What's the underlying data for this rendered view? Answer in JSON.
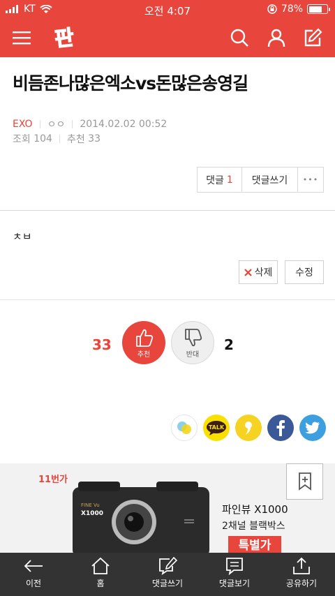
{
  "status_bar": {
    "carrier": "KT",
    "time": "오전 4:07",
    "battery": "78%",
    "battery_level": 0.78
  },
  "header": {
    "logo_text": "판",
    "icons": [
      "menu-icon",
      "search-icon",
      "user-icon",
      "edit-icon"
    ]
  },
  "post": {
    "title": "비듬존나많은엑소vs돈많은송영길",
    "category": "EXO",
    "author": "ㅇㅇ",
    "date": "2014.02.02 00:52",
    "views_label": "조회",
    "views": "104",
    "recommend_label": "추천",
    "recommend": "33",
    "body": "ㅊㅂ"
  },
  "actions": {
    "comment_label": "댓글",
    "comment_count": "1",
    "write_comment": "댓글쓰기",
    "more": "•••"
  },
  "edit": {
    "delete_label": "삭제",
    "edit_label": "수정"
  },
  "votes": {
    "up_count": "33",
    "up_label": "추천",
    "down_label": "반대",
    "down_count": "2"
  },
  "share": {
    "icons": [
      "kakaostory-icon",
      "kakaotalk-icon",
      "comma-icon",
      "facebook-icon",
      "twitter-icon"
    ],
    "talk_label": "TALK"
  },
  "ad": {
    "badge": "11번가",
    "product_title": "파인뷰 X1000",
    "product_sub": "2채널 블랙박스",
    "special_label": "특별가",
    "device_brand": "FINE Vu",
    "device_model": "X1000"
  },
  "bottom_nav": [
    {
      "label": "이전",
      "icon": "back-arrow-icon"
    },
    {
      "label": "홈",
      "icon": "home-icon"
    },
    {
      "label": "댓글쓰기",
      "icon": "write-comment-icon"
    },
    {
      "label": "댓글보기",
      "icon": "view-comments-icon"
    },
    {
      "label": "공유하기",
      "icon": "share-icon"
    }
  ],
  "colors": {
    "brand": "#e8453c",
    "bottom_bar": "#333333"
  }
}
